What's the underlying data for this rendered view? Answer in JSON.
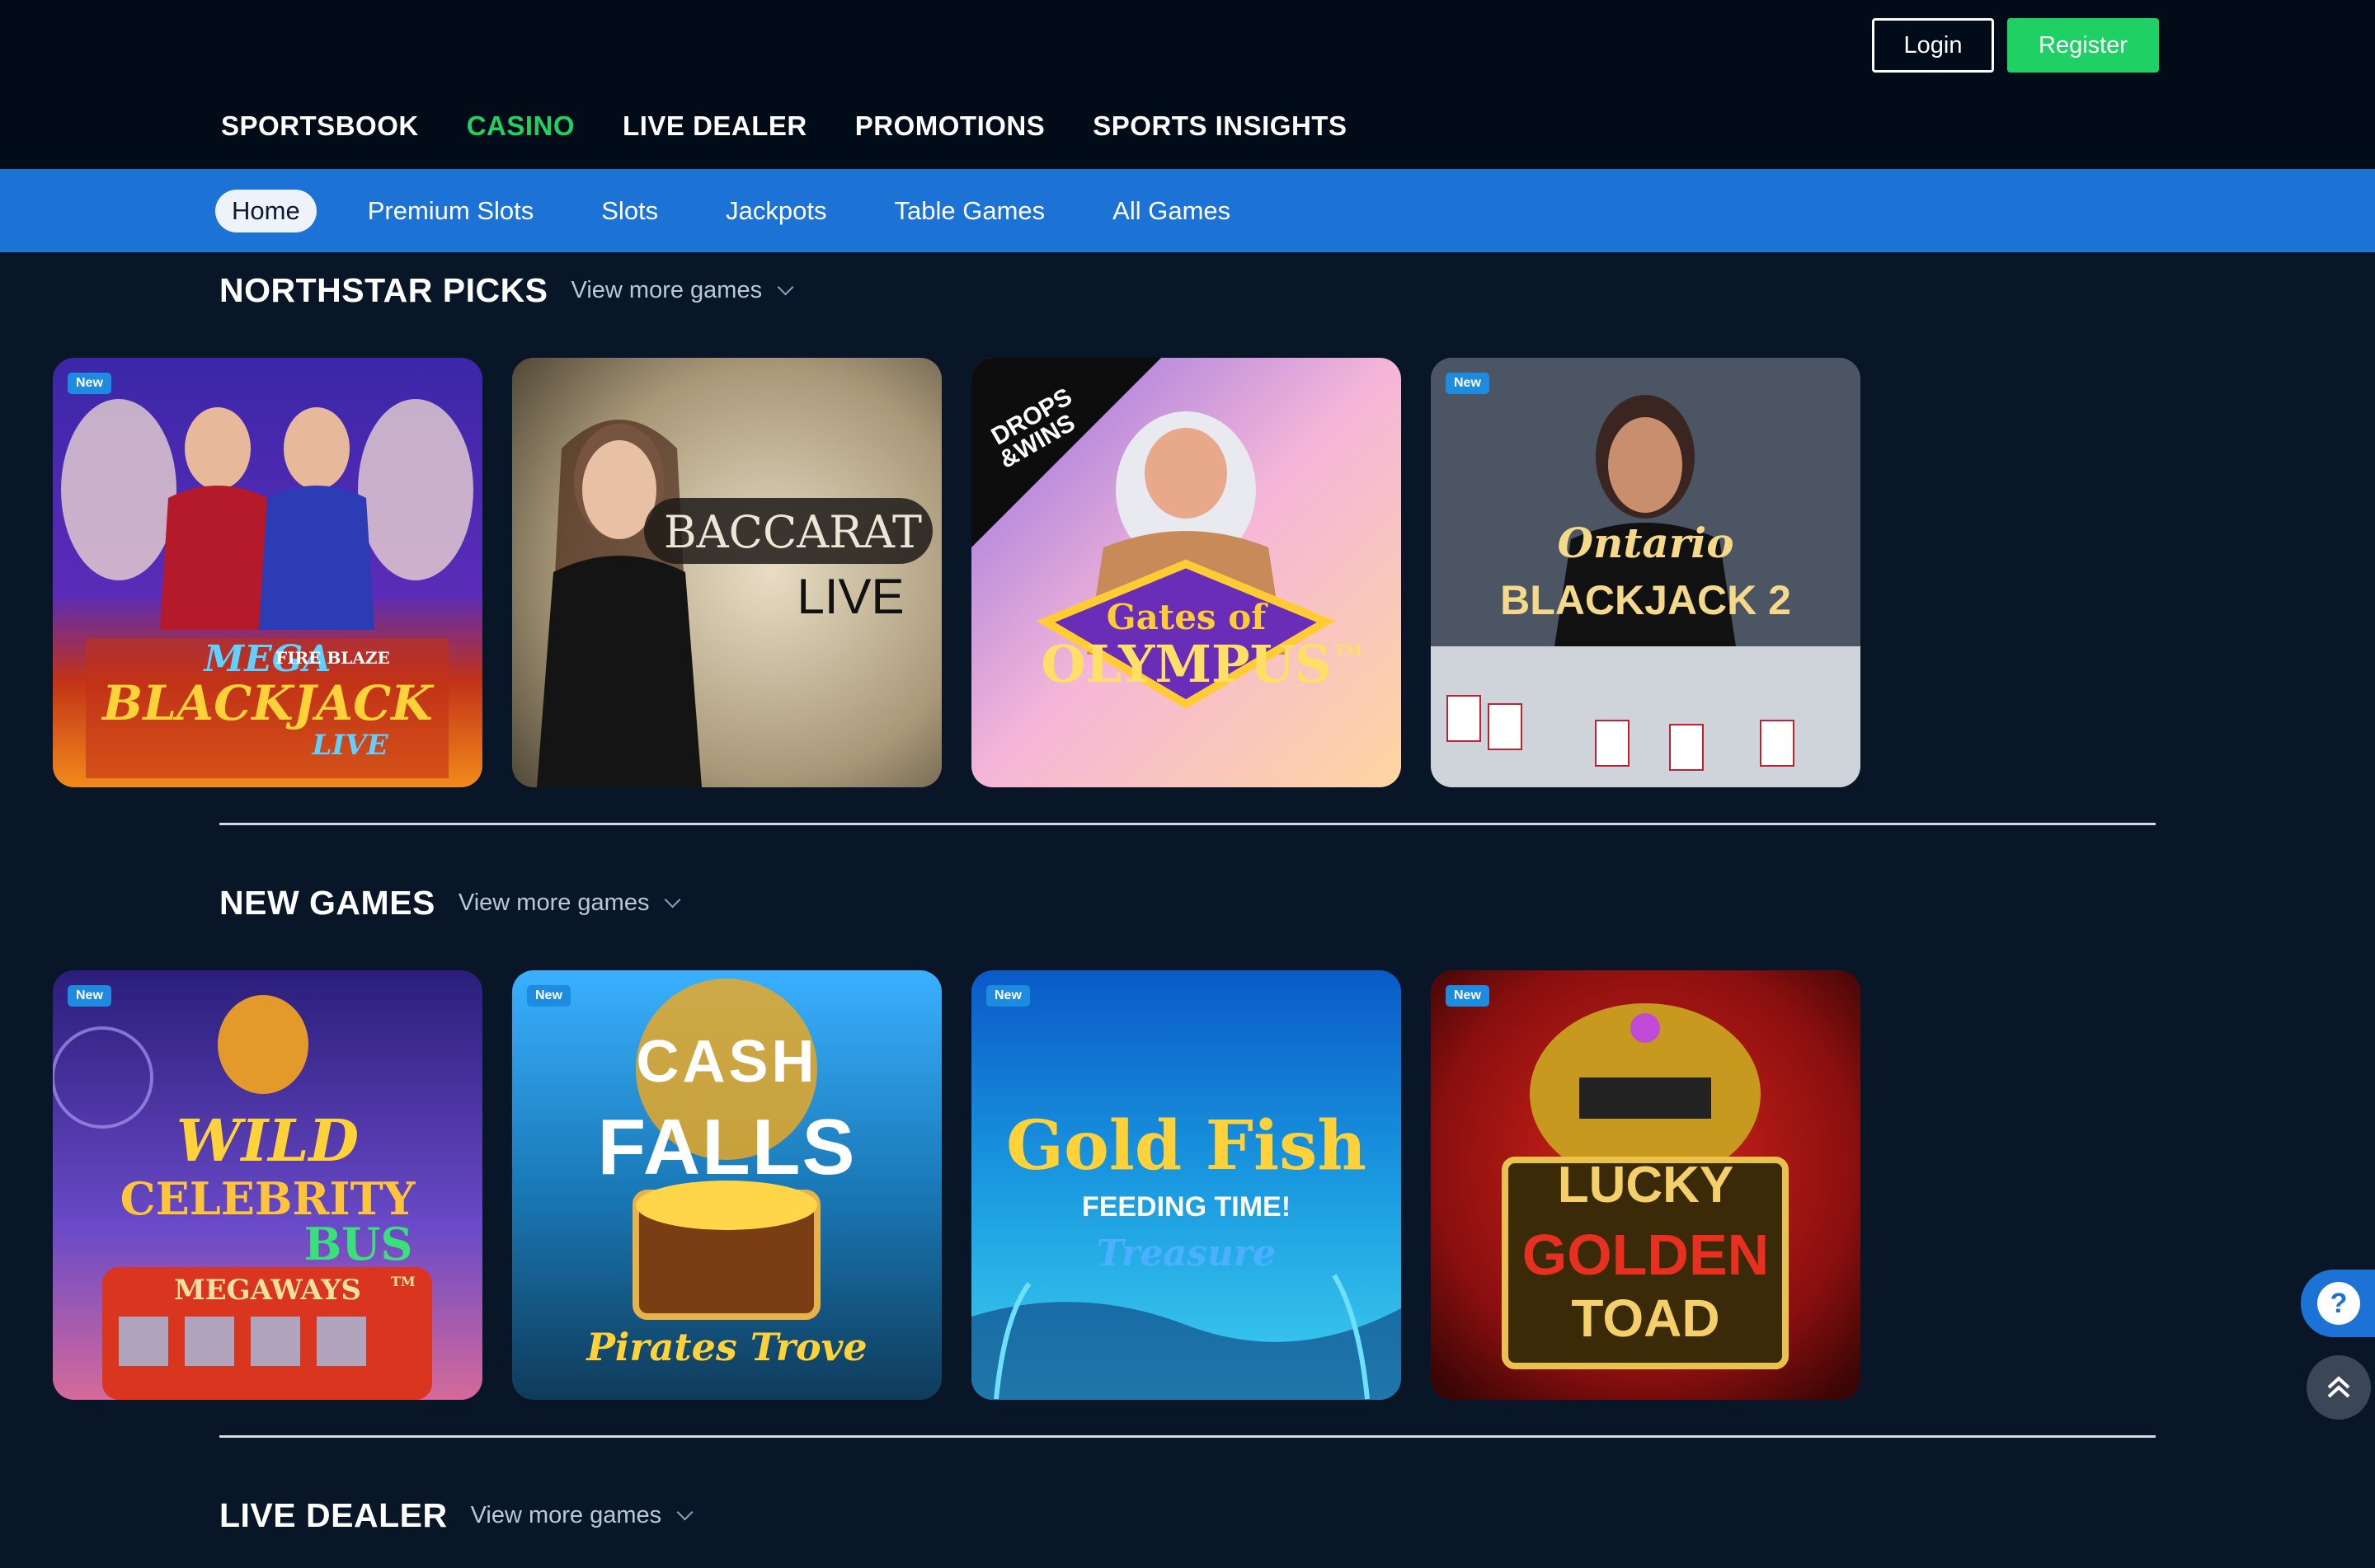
{
  "header": {
    "login_label": "Login",
    "register_label": "Register",
    "nav": [
      {
        "label": "SPORTSBOOK",
        "active": false
      },
      {
        "label": "CASINO",
        "active": true
      },
      {
        "label": "LIVE DEALER",
        "active": false
      },
      {
        "label": "PROMOTIONS",
        "active": false
      },
      {
        "label": "SPORTS INSIGHTS",
        "active": false
      }
    ]
  },
  "subnav": [
    {
      "label": "Home",
      "active": true
    },
    {
      "label": "Premium Slots",
      "active": false
    },
    {
      "label": "Slots",
      "active": false
    },
    {
      "label": "Jackpots",
      "active": false
    },
    {
      "label": "Table Games",
      "active": false
    },
    {
      "label": "All Games",
      "active": false
    }
  ],
  "sections": [
    {
      "title": "NORTHSTAR PICKS",
      "view_more": "View more games",
      "games": [
        {
          "art_text": [
            "MEGA",
            "FIRE BLAZE",
            "BLACKJACK",
            "LIVE"
          ],
          "badge": "New"
        },
        {
          "art_text": [
            "BACCARAT",
            "LIVE"
          ],
          "badge": ""
        },
        {
          "art_text": [
            "DROPS",
            "&WINS",
            "Gates of",
            "OLYMPUS",
            "TM"
          ],
          "badge": ""
        },
        {
          "art_text": [
            "Ontario",
            "BLACKJACK 2"
          ],
          "badge": "New"
        }
      ]
    },
    {
      "title": "NEW GAMES",
      "view_more": "View more games",
      "games": [
        {
          "art_text": [
            "WILD",
            "CELEBRITY",
            "BUS",
            "MEGAWAYS",
            "TM"
          ],
          "badge": "New"
        },
        {
          "art_text": [
            "CASH",
            "FALLS",
            "Pirates Trove"
          ],
          "badge": "New"
        },
        {
          "art_text": [
            "Gold Fish",
            "FEEDING TIME!",
            "Treasure"
          ],
          "badge": "New"
        },
        {
          "art_text": [
            "LUCKY",
            "GOLDEN",
            "TOAD"
          ],
          "badge": "New"
        }
      ]
    },
    {
      "title": "LIVE DEALER",
      "view_more": "View more games"
    }
  ],
  "colors": {
    "background": "#081628",
    "header": "#020b18",
    "subnav": "#1d72d6",
    "accent_green": "#1fd164"
  },
  "icons": {
    "help": "question-icon",
    "scroll_top": "double-chevron-up-icon",
    "view_more": "chevron-down-icon"
  },
  "help_glyph": "?"
}
